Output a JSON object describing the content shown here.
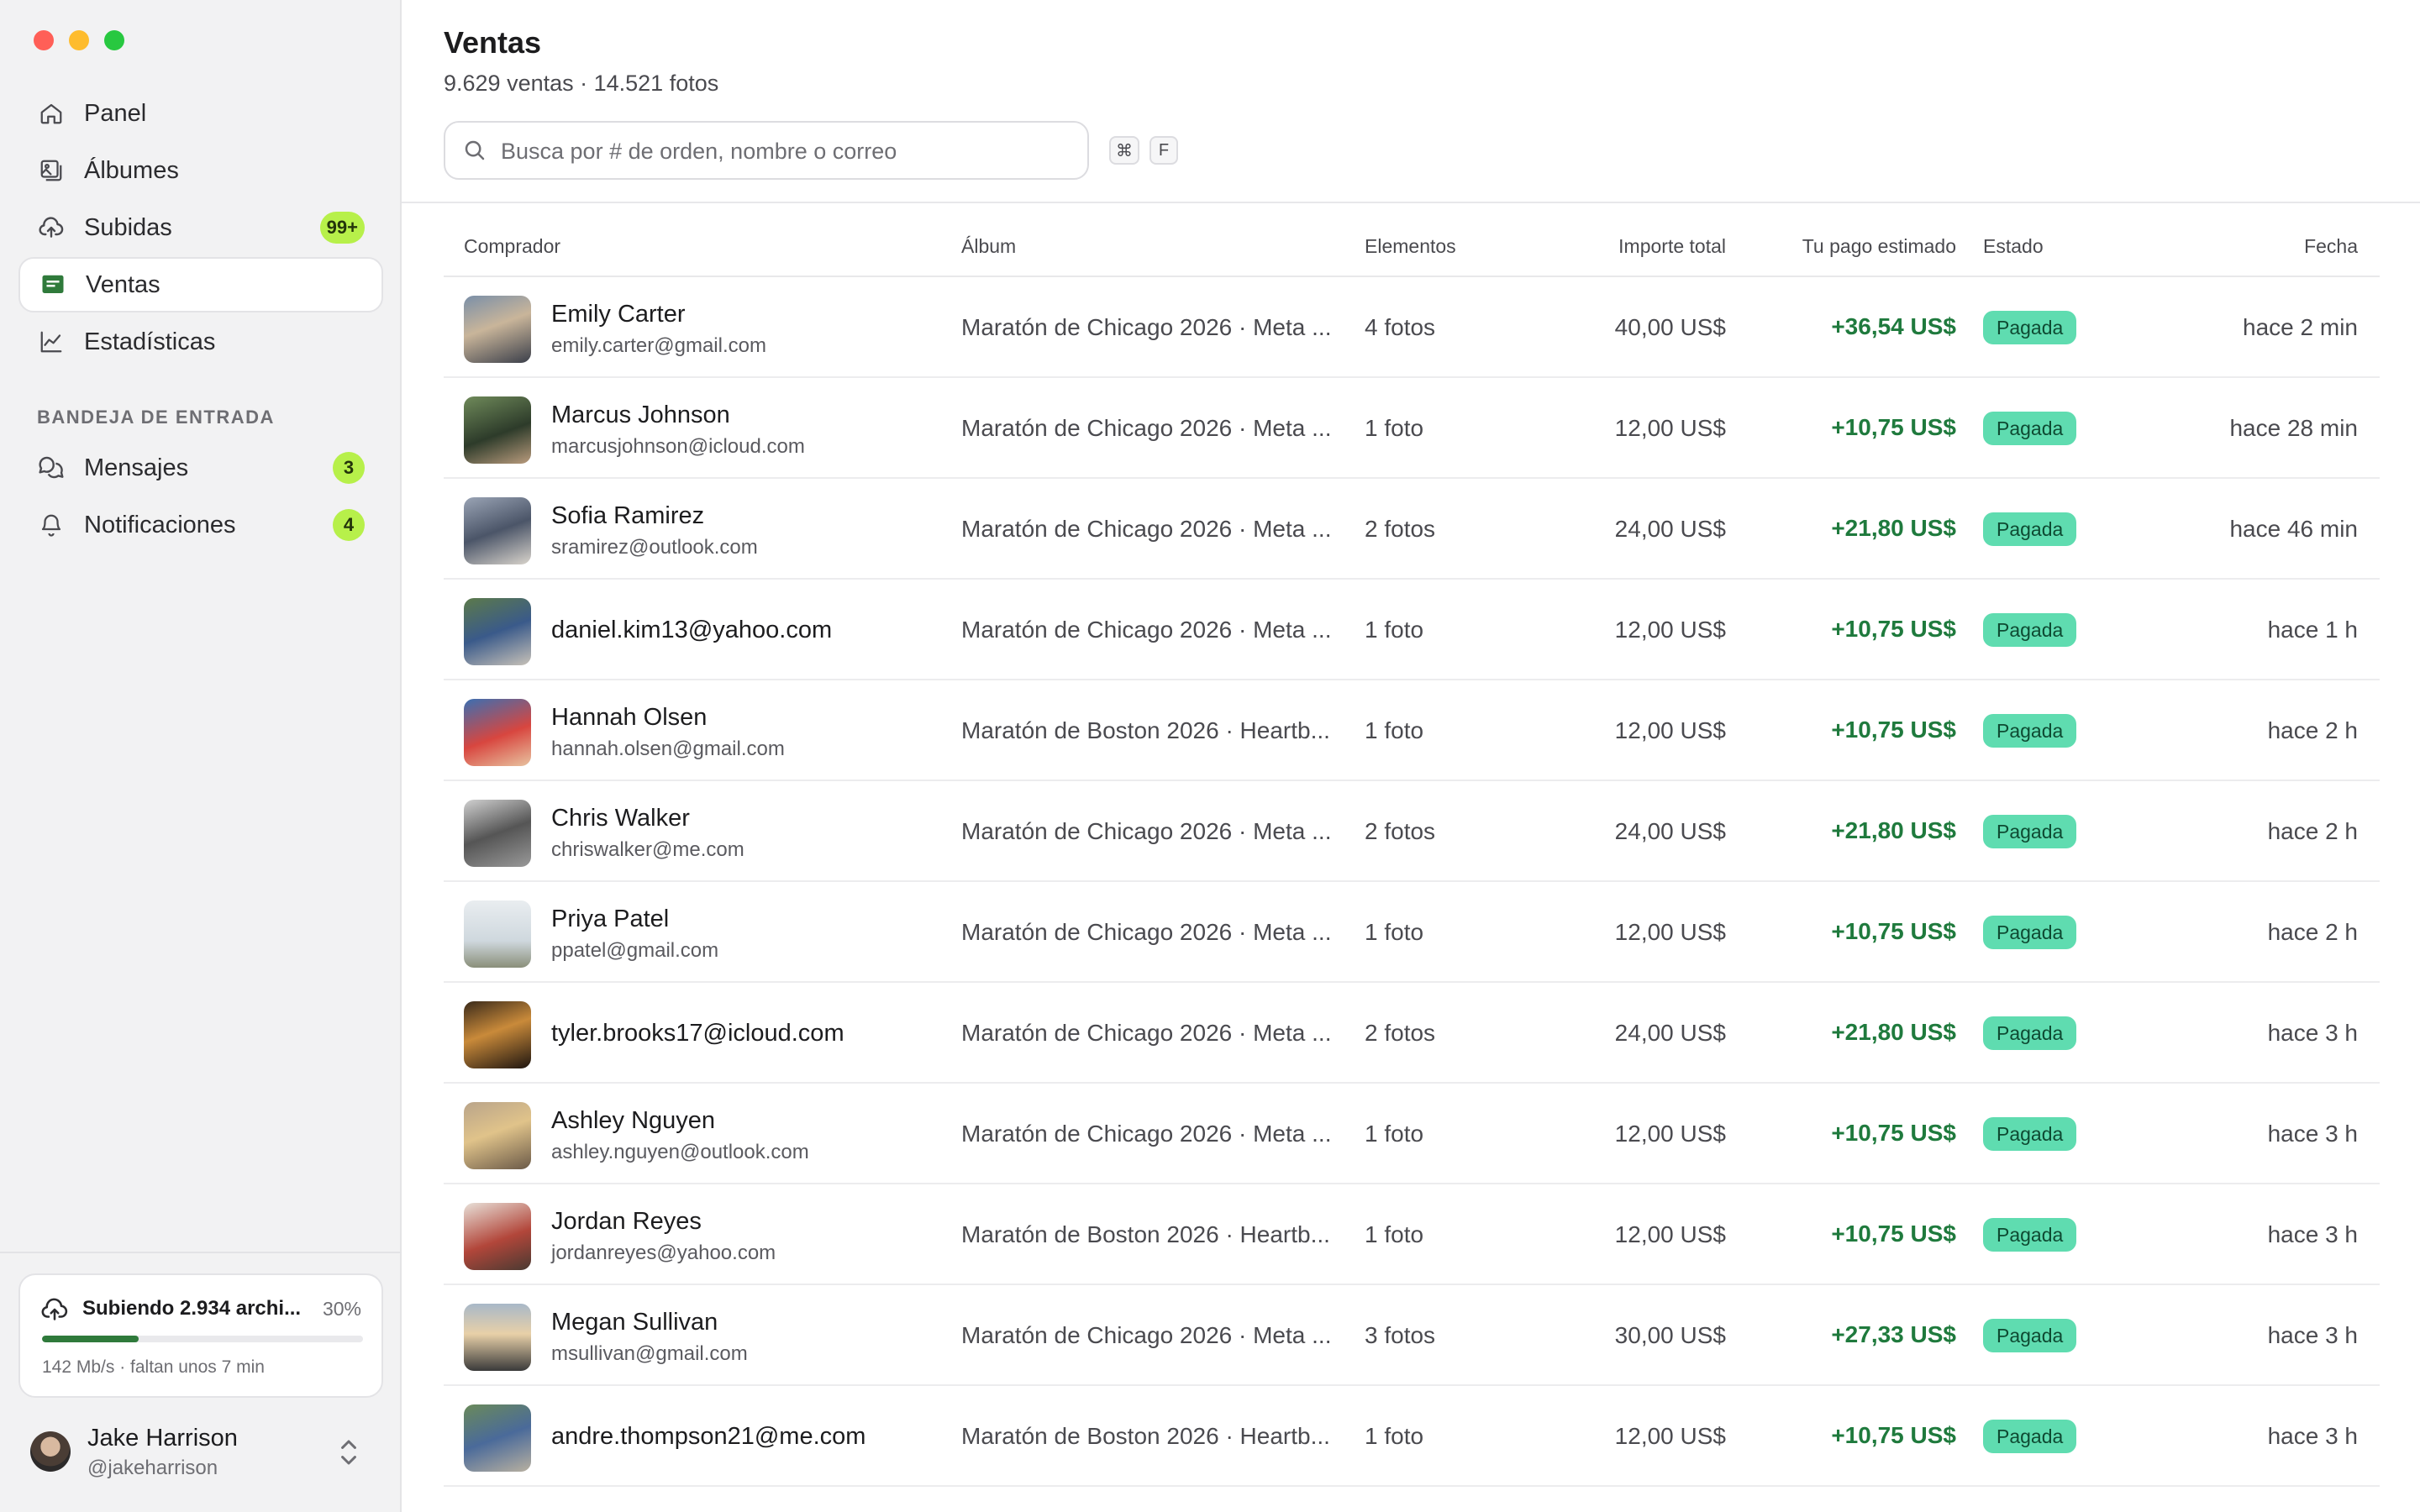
{
  "sidebar": {
    "nav": [
      {
        "label": "Panel",
        "icon": "home-icon"
      },
      {
        "label": "Álbumes",
        "icon": "photo-album-icon"
      },
      {
        "label": "Subidas",
        "icon": "cloud-upload-icon",
        "badge": "99+"
      },
      {
        "label": "Ventas",
        "icon": "sales-icon",
        "active": true
      },
      {
        "label": "Estadísticas",
        "icon": "chart-icon"
      }
    ],
    "inbox_title": "BANDEJA DE ENTRADA",
    "inbox": [
      {
        "label": "Mensajes",
        "icon": "chat-icon",
        "badge": "3"
      },
      {
        "label": "Notificaciones",
        "icon": "bell-icon",
        "badge": "4"
      }
    ],
    "upload": {
      "title": "Subiendo 2.934 archi...",
      "percent_label": "30%",
      "progress": 0.3,
      "meta": "142 Mb/s · faltan unos 7 min"
    },
    "user": {
      "name": "Jake Harrison",
      "handle": "@jakeharrison"
    }
  },
  "main": {
    "title": "Ventas",
    "subtitle": "9.629 ventas · 14.521 fotos",
    "search": {
      "placeholder": "Busca por # de orden, nombre o correo",
      "value": ""
    },
    "shortcut": [
      "⌘",
      "F"
    ],
    "columns": {
      "buyer": "Comprador",
      "album": "Álbum",
      "items": "Elementos",
      "amount": "Importe total",
      "payout": "Tu pago estimado",
      "status": "Estado",
      "date": "Fecha"
    },
    "rows": [
      {
        "name": "Emily Carter",
        "email": "emily.carter@gmail.com",
        "album": "Maratón de Chicago 2026 · Meta ...",
        "items": "4 fotos",
        "amount": "40,00 US$",
        "payout": "+36,54 US$",
        "status": "Pagada",
        "date": "hace 2 min"
      },
      {
        "name": "Marcus Johnson",
        "email": "marcusjohnson@icloud.com",
        "album": "Maratón de Chicago 2026 · Meta ...",
        "items": "1 foto",
        "amount": "12,00 US$",
        "payout": "+10,75 US$",
        "status": "Pagada",
        "date": "hace 28 min"
      },
      {
        "name": "Sofia Ramirez",
        "email": "sramirez@outlook.com",
        "album": "Maratón de Chicago 2026 · Meta ...",
        "items": "2 fotos",
        "amount": "24,00 US$",
        "payout": "+21,80 US$",
        "status": "Pagada",
        "date": "hace 46 min"
      },
      {
        "name": "",
        "email": "daniel.kim13@yahoo.com",
        "album": "Maratón de Chicago 2026 · Meta ...",
        "items": "1 foto",
        "amount": "12,00 US$",
        "payout": "+10,75 US$",
        "status": "Pagada",
        "date": "hace 1 h"
      },
      {
        "name": "Hannah Olsen",
        "email": "hannah.olsen@gmail.com",
        "album": "Maratón de Boston 2026 · Heartb...",
        "items": "1 foto",
        "amount": "12,00 US$",
        "payout": "+10,75 US$",
        "status": "Pagada",
        "date": "hace 2 h"
      },
      {
        "name": "Chris Walker",
        "email": "chriswalker@me.com",
        "album": "Maratón de Chicago 2026 · Meta ...",
        "items": "2 fotos",
        "amount": "24,00 US$",
        "payout": "+21,80 US$",
        "status": "Pagada",
        "date": "hace 2 h"
      },
      {
        "name": "Priya Patel",
        "email": "ppatel@gmail.com",
        "album": "Maratón de Chicago 2026 · Meta ...",
        "items": "1 foto",
        "amount": "12,00 US$",
        "payout": "+10,75 US$",
        "status": "Pagada",
        "date": "hace 2 h"
      },
      {
        "name": "",
        "email": "tyler.brooks17@icloud.com",
        "album": "Maratón de Chicago 2026 · Meta ...",
        "items": "2 fotos",
        "amount": "24,00 US$",
        "payout": "+21,80 US$",
        "status": "Pagada",
        "date": "hace 3 h"
      },
      {
        "name": "Ashley Nguyen",
        "email": "ashley.nguyen@outlook.com",
        "album": "Maratón de Chicago 2026 · Meta ...",
        "items": "1 foto",
        "amount": "12,00 US$",
        "payout": "+10,75 US$",
        "status": "Pagada",
        "date": "hace 3 h"
      },
      {
        "name": "Jordan Reyes",
        "email": "jordanreyes@yahoo.com",
        "album": "Maratón de Boston 2026 · Heartb...",
        "items": "1 foto",
        "amount": "12,00 US$",
        "payout": "+10,75 US$",
        "status": "Pagada",
        "date": "hace 3 h"
      },
      {
        "name": "Megan Sullivan",
        "email": "msullivan@gmail.com",
        "album": "Maratón de Chicago 2026 · Meta ...",
        "items": "3 fotos",
        "amount": "30,00 US$",
        "payout": "+27,33 US$",
        "status": "Pagada",
        "date": "hace 3 h"
      },
      {
        "name": "",
        "email": "andre.thompson21@me.com",
        "album": "Maratón de Boston 2026 · Heartb...",
        "items": "1 foto",
        "amount": "12,00 US$",
        "payout": "+10,75 US$",
        "status": "Pagada",
        "date": "hace 3 h"
      }
    ]
  },
  "colors": {
    "accent_badge": "#b7f04a",
    "payout_green": "#1f7a3d",
    "status_pill": "#5fdcb0",
    "progress_fill": "#2f7a3b"
  }
}
